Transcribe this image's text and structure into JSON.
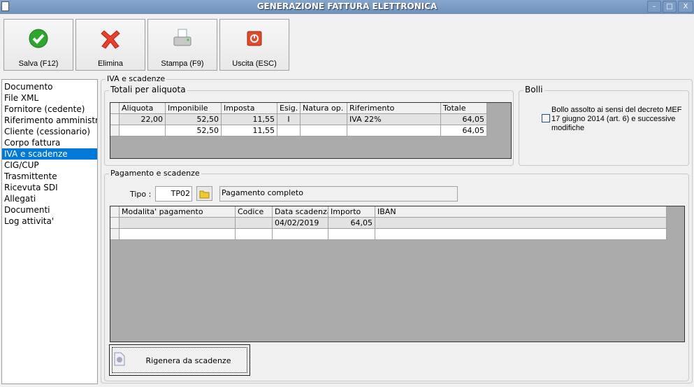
{
  "window": {
    "title": "GENERAZIONE FATTURA ELETTRONICA",
    "minimize": "–",
    "maximize": "□",
    "close": "X"
  },
  "toolbar": [
    {
      "label": "Salva (F12)",
      "icon": "check-icon"
    },
    {
      "label": "Elimina",
      "icon": "x-icon"
    },
    {
      "label": "Stampa (F9)",
      "icon": "printer-icon"
    },
    {
      "label": "Uscita (ESC)",
      "icon": "power-icon"
    }
  ],
  "sidebar": {
    "items": [
      "Documento",
      "File XML",
      "Fornitore (cedente)",
      "Riferimento amministrativo",
      "Cliente (cessionario)",
      "Corpo fattura",
      "IVA e scadenze",
      "CIG/CUP",
      "Trasmittente",
      "Ricevuta SDI",
      "Allegati",
      "Documenti",
      "Log attivita'"
    ],
    "selected": "IVA e scadenze"
  },
  "main": {
    "group_title": "IVA e scadenze",
    "totali": {
      "title": "Totali per aliquota",
      "columns": [
        "Aliquota",
        "Imponibile",
        "Imposta",
        "Esig.",
        "Natura op.",
        "Riferimento",
        "Totale"
      ],
      "rows": [
        [
          "22,00",
          "52,50",
          "11,55",
          "I",
          "",
          "IVA 22%",
          "64,05"
        ],
        [
          "",
          "52,50",
          "11,55",
          "",
          "",
          "",
          "64,05"
        ]
      ]
    },
    "bolli": {
      "title": "Bolli",
      "checkbox_label": "Bollo assolto ai sensi del decreto MEF 17 giugno 2014 (art. 6) e successive modifiche",
      "checked": false
    },
    "pagamento": {
      "title": "Pagamento e scadenze",
      "tipo_label": "Tipo :",
      "tipo_value": "TP02",
      "tipo_desc": "Pagamento completo",
      "columns": [
        "Modalita' pagamento",
        "Codice",
        "Data scadenza",
        "Importo",
        "IBAN"
      ],
      "rows": [
        [
          "",
          "",
          "04/02/2019",
          "64,05",
          ""
        ],
        [
          "",
          "",
          "",
          "",
          ""
        ]
      ]
    },
    "rigenera_label": "Rigenera da scadenze"
  }
}
